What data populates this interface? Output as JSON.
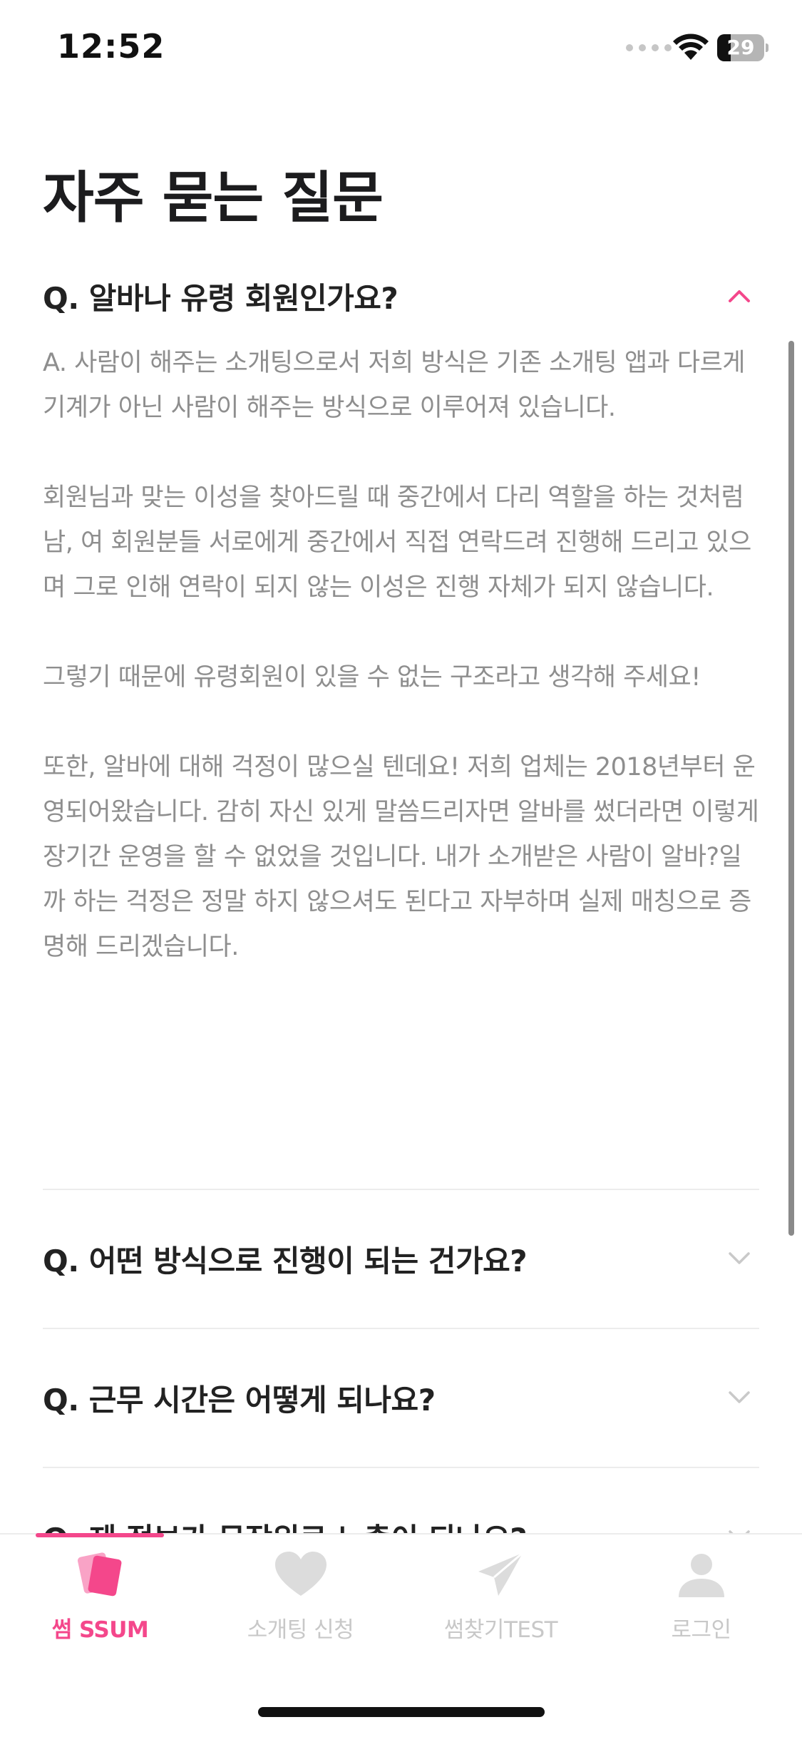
{
  "status_bar": {
    "time": "12:52",
    "battery": "29",
    "battery_level": 0.29
  },
  "page": {
    "title": "자주 묻는 질문"
  },
  "faq_open": {
    "question": "Q. 알바나 유령 회원인가요?",
    "answer": [
      "A. 사람이 해주는 소개팅으로서 저희 방식은 기존 소개팅 앱과 다르게 기계가 아닌 사람이 해주는 방식으로 이루어져 있습니다.",
      "회원님과 맞는 이성을 찾아드릴 때 중간에서 다리 역할을 하는  것처럼 남, 여 회원분들 서로에게 중간에서 직접 연락드려 진행해 드리고 있으며 그로 인해 연락이 되지 않는 이성은 진행 자체가 되지 않습니다.",
      "그렇기 때문에 유령회원이 있을 수 없는 구조라고 생각해 주세요!",
      "또한, 알바에 대해 걱정이 많으실 텐데요! 저희 업체는 2018년부터 운영되어왔습니다. 감히 자신 있게 말씀드리자면 알바를 썼더라면 이렇게 장기간 운영을 할 수 없었을 것입니다. 내가 소개받은 사람이 알바?일까 하는 걱정은 정말 하지 않으셔도 된다고 자부하며 실제 매칭으로 증명해 드리겠습니다."
    ]
  },
  "faq_closed": [
    {
      "question": "Q. 어떤 방식으로 진행이 되는 건가요?"
    },
    {
      "question": "Q. 근무 시간은 어떻게 되나요?"
    },
    {
      "question": "Q. 제 정보가 무작위로 노출이 되나요?"
    }
  ],
  "tabs": [
    {
      "label": "썸 SSUM",
      "icon": "cards-icon",
      "active": true
    },
    {
      "label": "소개팅 신청",
      "icon": "heart-icon",
      "active": false
    },
    {
      "label": "썸찾기TEST",
      "icon": "paper-plane-icon",
      "active": false
    },
    {
      "label": "로그인",
      "icon": "person-icon",
      "active": false
    }
  ],
  "colors": {
    "accent": "#f4478b",
    "text": "#222222",
    "muted": "#8e8e8e",
    "tab_inactive": "#c8c8c8"
  }
}
